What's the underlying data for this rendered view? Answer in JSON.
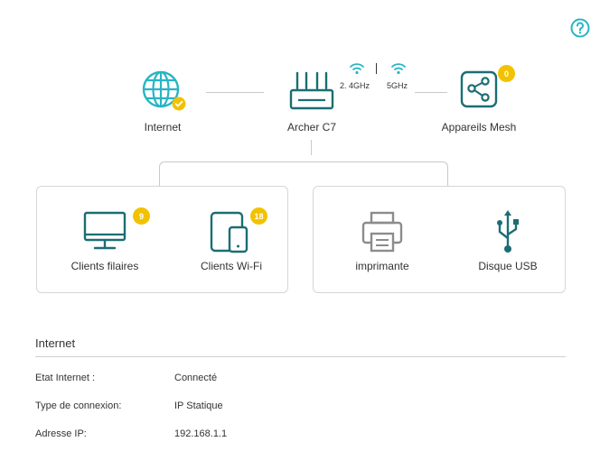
{
  "colors": {
    "teal": "#1a6e73",
    "accent_teal": "#27b5c4",
    "badge": "#f2c200",
    "ok": "#f2c200",
    "gray_icon": "#8c8c8c"
  },
  "topology": {
    "internet": {
      "label": "Internet",
      "icon": "globe-icon"
    },
    "router": {
      "label": "Archer C7",
      "icon": "router-icon"
    },
    "wifi_24": {
      "label": "2. 4GHz",
      "icon": "wifi-icon"
    },
    "wifi_5": {
      "label": "5GHz",
      "icon": "wifi-icon"
    },
    "mesh": {
      "label": "Appareils Mesh",
      "icon": "mesh-icon",
      "count": "0"
    }
  },
  "clients": {
    "wired": {
      "label": "Clients filaires",
      "icon": "monitor-icon",
      "count": "9"
    },
    "wifi": {
      "label": "Clients Wi-Fi",
      "icon": "tablet-icon",
      "count": "18"
    }
  },
  "usb": {
    "printer": {
      "label": "imprimante",
      "icon": "printer-icon"
    },
    "disk": {
      "label": "Disque USB",
      "icon": "usb-icon"
    }
  },
  "internet_section": {
    "title": "Internet",
    "rows": [
      {
        "key": "Etat Internet :",
        "value": "Connecté"
      },
      {
        "key": "Type de connexion:",
        "value": "IP Statique"
      },
      {
        "key": "Adresse IP:",
        "value": "192.168.1.1"
      }
    ]
  }
}
